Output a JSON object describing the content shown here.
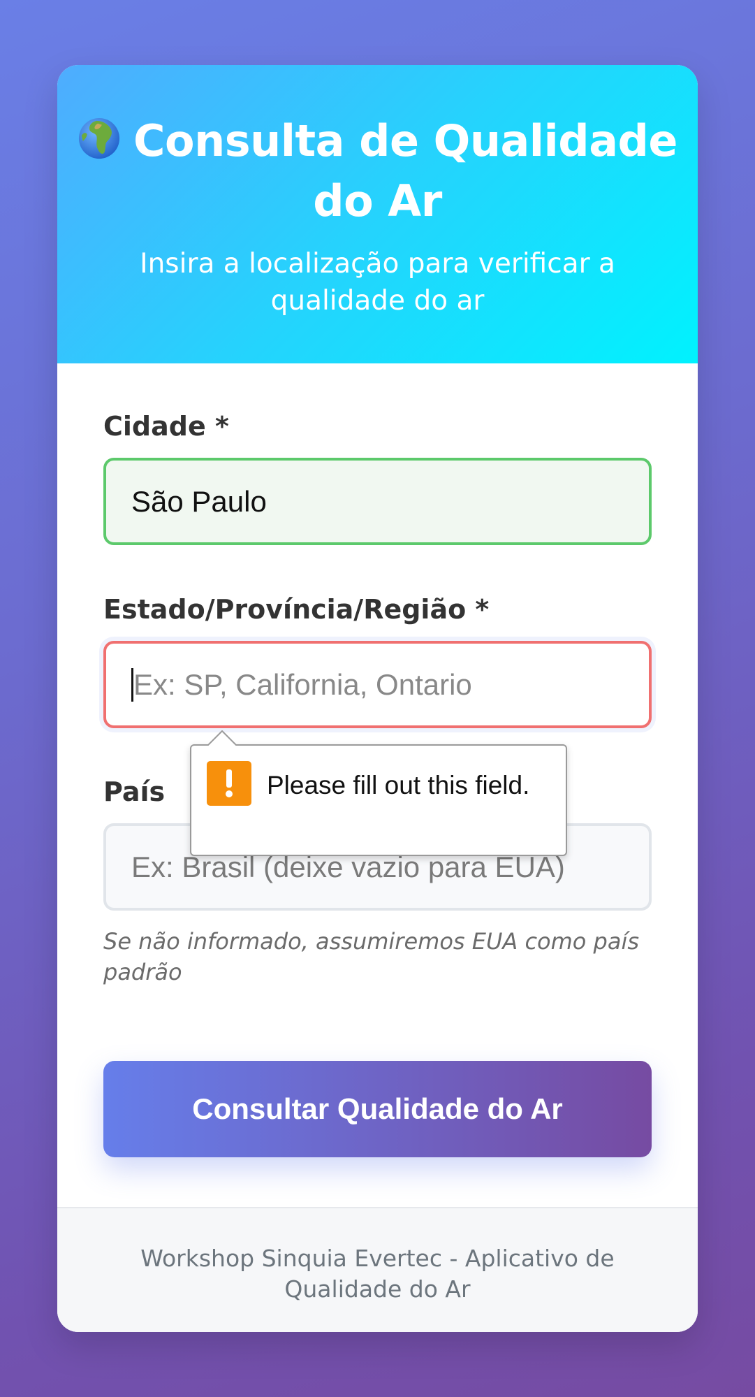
{
  "header": {
    "title": "Consulta de Qualidade do Ar",
    "subtitle": "Insira a localização para verificar a qualidade do ar"
  },
  "form": {
    "city": {
      "label": "Cidade *",
      "value": "São Paulo"
    },
    "state": {
      "label": "Estado/Província/Região *",
      "placeholder": "Ex: SP, California, Ontario"
    },
    "country": {
      "label": "País",
      "placeholder": "Ex: Brasil (deixe vazio para EUA)",
      "hint": "Se não informado, assumiremos EUA como país padrão"
    },
    "submit_label": "Consultar Qualidade do Ar"
  },
  "validation": {
    "message": "Please fill out this field."
  },
  "footer": {
    "text": "Workshop Sinquia Evertec - Aplicativo de Qualidade do Ar"
  },
  "colors": {
    "header_gradient_start": "#4facfe",
    "header_gradient_end": "#00f2fe",
    "button_gradient_start": "#667eea",
    "button_gradient_end": "#764ba2",
    "valid_border": "#5cc96b",
    "invalid_border": "#f07070",
    "warning": "#f7900c"
  },
  "icons": {
    "title_icon": "globe-africa-icon",
    "validation_icon": "warning-icon"
  }
}
